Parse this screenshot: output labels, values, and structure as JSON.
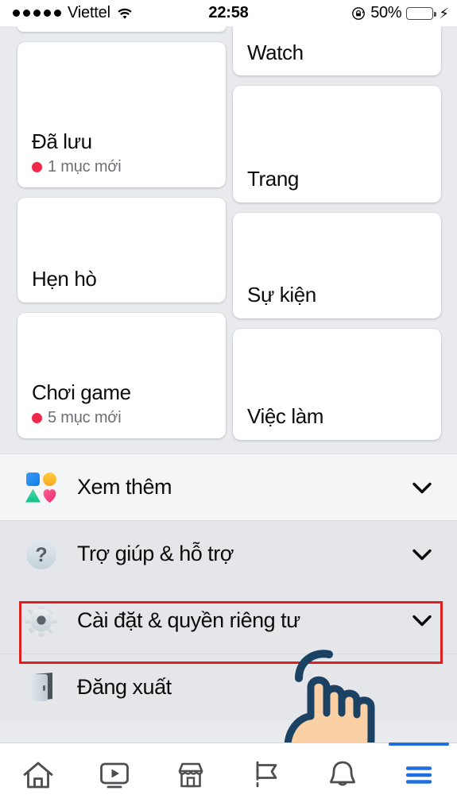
{
  "status_bar": {
    "signal_dots": 5,
    "carrier": "Viettel",
    "wifi_icon": "wifi-icon",
    "time": "22:58",
    "rotation_lock_icon": "rotation-lock-icon",
    "battery_percent": "50%",
    "battery_level": 50,
    "battery_color": "#4cd964",
    "charging_icon": "lightning-bolt-icon"
  },
  "shortcuts_grid": {
    "left_column": [
      {
        "title": "",
        "badge": "",
        "partial": true
      },
      {
        "title": "Đã lưu",
        "badge": "1 mục mới",
        "partial": false
      },
      {
        "title": "Hẹn hò",
        "badge": "",
        "partial": false
      },
      {
        "title": "Chơi game",
        "badge": "5 mục mới",
        "partial": false
      }
    ],
    "right_column": [
      {
        "title": "Watch",
        "badge": "",
        "partial": true
      },
      {
        "title": "Trang",
        "badge": "",
        "partial": false
      },
      {
        "title": "Sự kiện",
        "badge": "",
        "partial": false
      },
      {
        "title": "Việc làm",
        "badge": "",
        "partial": false
      }
    ],
    "badge_dot_color": "#f02849"
  },
  "menu_rows": [
    {
      "label": "Xem thêm",
      "icon": "four-shapes-icon",
      "chevron": "chevron-down-icon",
      "highlighted": false
    },
    {
      "label": "Trợ giúp & hỗ trợ",
      "icon": "question-mark-circle-icon",
      "chevron": "chevron-down-icon",
      "highlighted": false
    },
    {
      "label": "Cài đặt & quyền riêng tư",
      "icon": "gear-icon",
      "chevron": "chevron-down-icon",
      "highlighted": true
    },
    {
      "label": "Đăng xuất",
      "icon": "door-exit-icon",
      "chevron": "",
      "highlighted": false
    }
  ],
  "annotation": {
    "highlight_border_color": "#e02020",
    "cursor_icon": "tap-hand-cursor-icon",
    "cursor_fill": "#fbd0a4",
    "cursor_outline": "#1b4263"
  },
  "tab_bar": {
    "active_index": 5,
    "active_color": "#1f6fe0",
    "inactive_color": "#4b4d50",
    "tabs": [
      {
        "name": "home-icon",
        "label": "Trang chủ"
      },
      {
        "name": "watch-video-icon",
        "label": "Watch"
      },
      {
        "name": "marketplace-icon",
        "label": "Marketplace"
      },
      {
        "name": "groups-flag-icon",
        "label": "Nhóm"
      },
      {
        "name": "notifications-bell-icon",
        "label": "Thông báo"
      },
      {
        "name": "hamburger-menu-icon",
        "label": "Menu"
      }
    ]
  }
}
